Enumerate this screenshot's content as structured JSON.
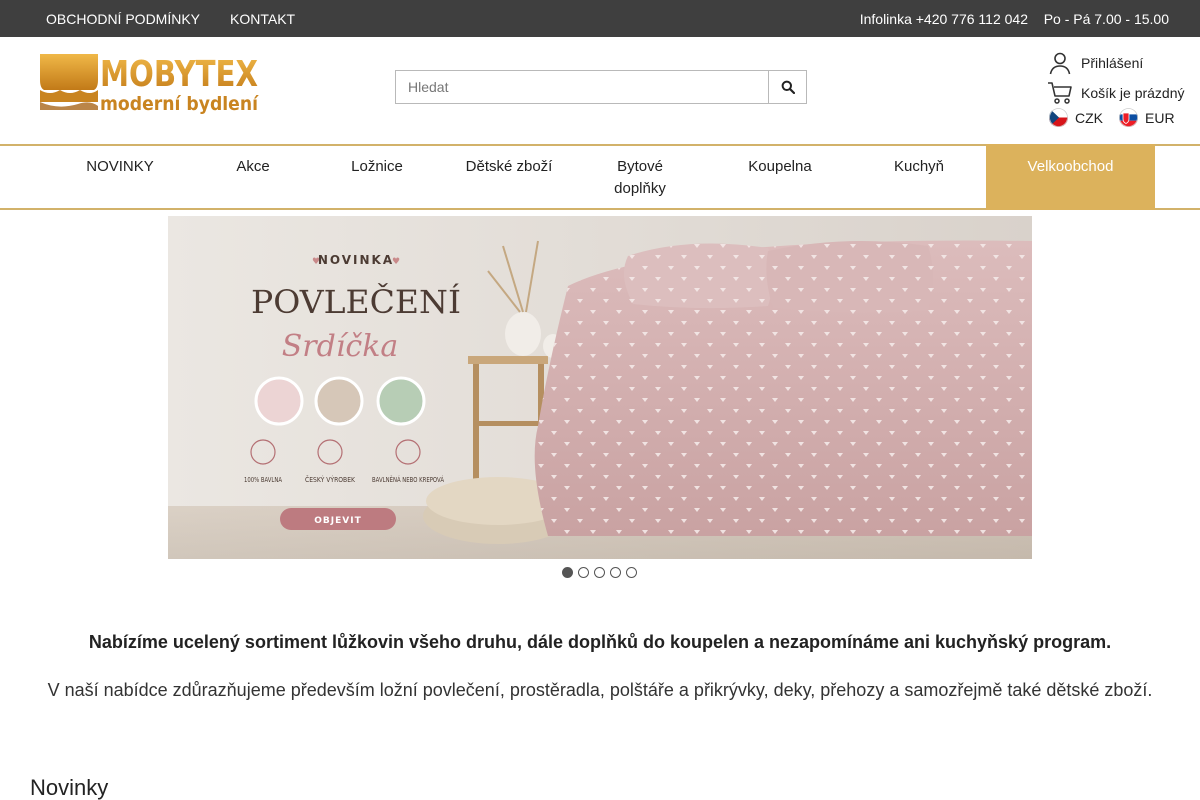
{
  "topbar": {
    "terms": "OBCHODNÍ PODMÍNKY",
    "contact": "KONTAKT",
    "hotline": "Infolinka +420 776 112 042",
    "hours": "Po - Pá 7.00 - 15.00"
  },
  "logo": {
    "brand": "MOBYTEX",
    "tagline": "moderní bydlení",
    "colors": {
      "gold": "#d79a2a",
      "dark_gold": "#b5761a"
    }
  },
  "search": {
    "placeholder": "Hledat",
    "icon": "search-icon"
  },
  "account": {
    "login": "Přihlášení",
    "cart": "Košík je prázdný",
    "currencies": [
      {
        "flag": "cz-flag-icon",
        "code": "CZK"
      },
      {
        "flag": "sk-flag-icon",
        "code": "EUR"
      }
    ]
  },
  "nav": {
    "items": [
      {
        "label": "NOVINKY"
      },
      {
        "label": "Akce"
      },
      {
        "label": "Ložnice"
      },
      {
        "label": "Dětské zboží"
      },
      {
        "label": "Bytové doplňky"
      },
      {
        "label": "Koupelna"
      },
      {
        "label": "Kuchyň"
      },
      {
        "label": "Velkoobchod",
        "active": true
      }
    ],
    "accent": "#dcb25c"
  },
  "banner": {
    "kicker": "NOVINKA",
    "title": "POVLEČENÍ",
    "script_title": "Srdíčka",
    "features": [
      "100% BAVLNA",
      "ČESKÝ VÝROBEK",
      "BAVLNĚNÁ NEBO KREPOVÁ"
    ],
    "cta": "OBJEVIT",
    "slide_count": 5,
    "active_slide": 1
  },
  "content": {
    "intro_bold": "Nabízíme ucelený sortiment lůžkovin všeho druhu, dále doplňků do koupelen a nezapomínáme ani kuchyňský program.",
    "intro": "V naší nabídce zdůrazňujeme především ložní povlečení, prostěradla, polštáře a přikrývky, deky, přehozy a samozřejmě také dětské zboží.",
    "section_title": "Novinky"
  }
}
